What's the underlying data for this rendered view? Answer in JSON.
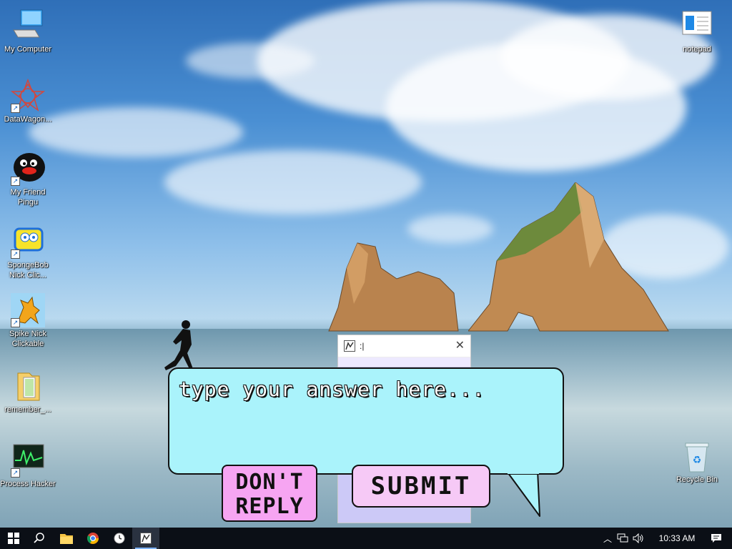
{
  "desktop": {
    "icons": [
      {
        "label": "My Computer",
        "icon": "computer-icon"
      },
      {
        "label": "DataWagon...",
        "icon": "datawagon-icon"
      },
      {
        "label": "My Friend Pingu",
        "icon": "pingu-icon"
      },
      {
        "label": "SpongeBob Nick Clic...",
        "icon": "spongebob-icon"
      },
      {
        "label": "Spike Nick Clickable",
        "icon": "spike-icon"
      },
      {
        "label": "remember_...",
        "icon": "folder-icon"
      },
      {
        "label": "Process Hacker",
        "icon": "process-hacker-icon"
      },
      {
        "label": "notepad",
        "icon": "notepad-icon"
      },
      {
        "label": "Recycle Bin",
        "icon": "recycle-bin-icon"
      }
    ]
  },
  "dialog": {
    "title": ":|",
    "close_glyph": "✕"
  },
  "bubble": {
    "placeholder": "type your answer here...",
    "dont_reply_label": "DON'T REPLY",
    "submit_label": "SUBMIT"
  },
  "taskbar": {
    "items": [
      "start-icon",
      "search-icon",
      "file-explorer-icon",
      "chrome-icon",
      "clock-app-icon",
      "dialog-app-icon"
    ],
    "clock": "10:33 AM"
  },
  "colors": {
    "bubble": "#aaf3fb",
    "dont_reply": "#f6a5f2",
    "submit": "#f6c9f6",
    "dialog_body": "#ccc9f7",
    "taskbar": "#0b0f16"
  }
}
